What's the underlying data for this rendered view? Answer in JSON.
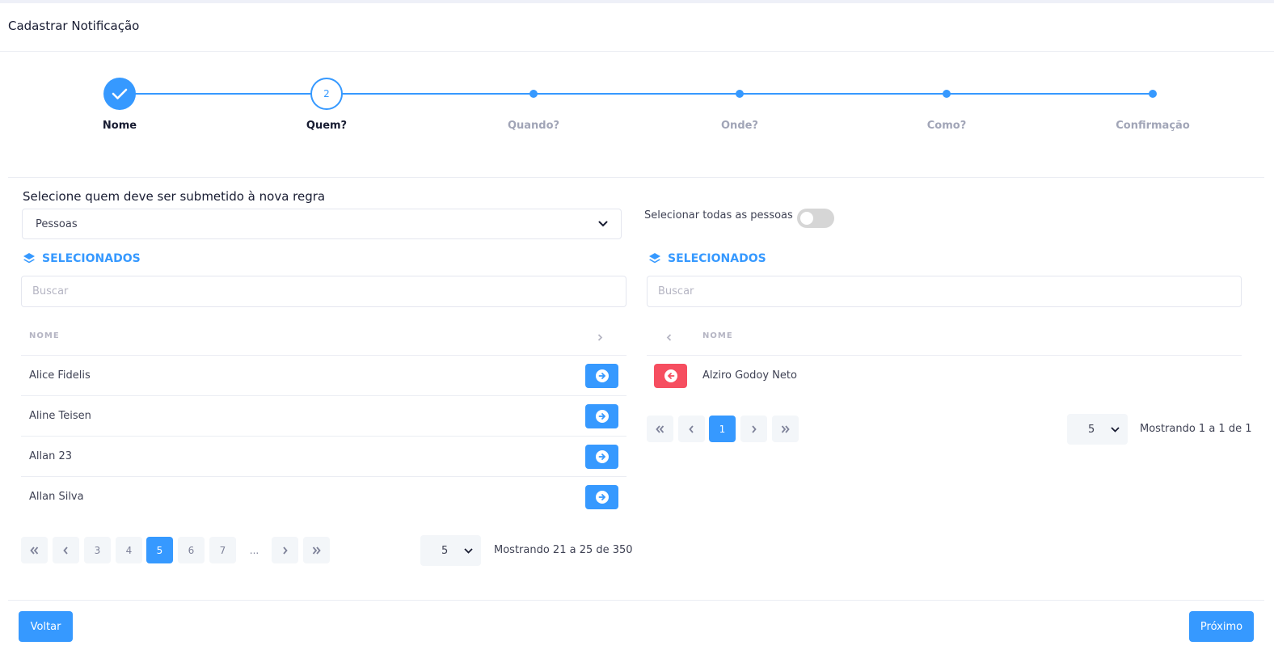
{
  "header": {
    "title": "Cadastrar Notificação"
  },
  "stepper": {
    "steps": [
      {
        "label": "Nome",
        "state": "done"
      },
      {
        "label": "Quem?",
        "state": "active",
        "number": "2"
      },
      {
        "label": "Quando?",
        "state": "pending"
      },
      {
        "label": "Onde?",
        "state": "pending"
      },
      {
        "label": "Como?",
        "state": "pending"
      },
      {
        "label": "Confirmação",
        "state": "pending"
      }
    ]
  },
  "form": {
    "section_label": "Selecione quem deve ser submetido à nova regra",
    "target_select": {
      "value": "Pessoas"
    },
    "select_all": {
      "label": "Selecionar todas as pessoas",
      "checked": false
    }
  },
  "left_panel": {
    "title": "SELECIONADOS",
    "search_placeholder": "Buscar",
    "column_header": "NOME",
    "rows": [
      {
        "name": "Alice Fidelis"
      },
      {
        "name": "Aline Teisen"
      },
      {
        "name": "Allan 23"
      },
      {
        "name": "Allan Silva"
      }
    ],
    "pagination": {
      "pages": [
        "3",
        "4",
        "5",
        "6",
        "7"
      ],
      "current": "5",
      "ellipsis": "..."
    },
    "page_size": "5",
    "showing": "Mostrando 21 a 25 de 350"
  },
  "right_panel": {
    "title": "SELECIONADOS",
    "search_placeholder": "Buscar",
    "column_header": "NOME",
    "rows": [
      {
        "name": "Alziro Godoy Neto"
      }
    ],
    "pagination": {
      "pages": [
        "1"
      ],
      "current": "1"
    },
    "page_size": "5",
    "showing": "Mostrando 1 a 1 de 1"
  },
  "footer": {
    "back_label": "Voltar",
    "next_label": "Próximo"
  },
  "colors": {
    "primary": "#3699ff",
    "danger": "#f64e60",
    "muted": "#a1a5b7"
  },
  "icons": {
    "done_step": "check-icon",
    "panel_title": "layers-icon",
    "add_row": "arrow-right-circle-icon",
    "remove_row": "arrow-left-circle-icon"
  }
}
